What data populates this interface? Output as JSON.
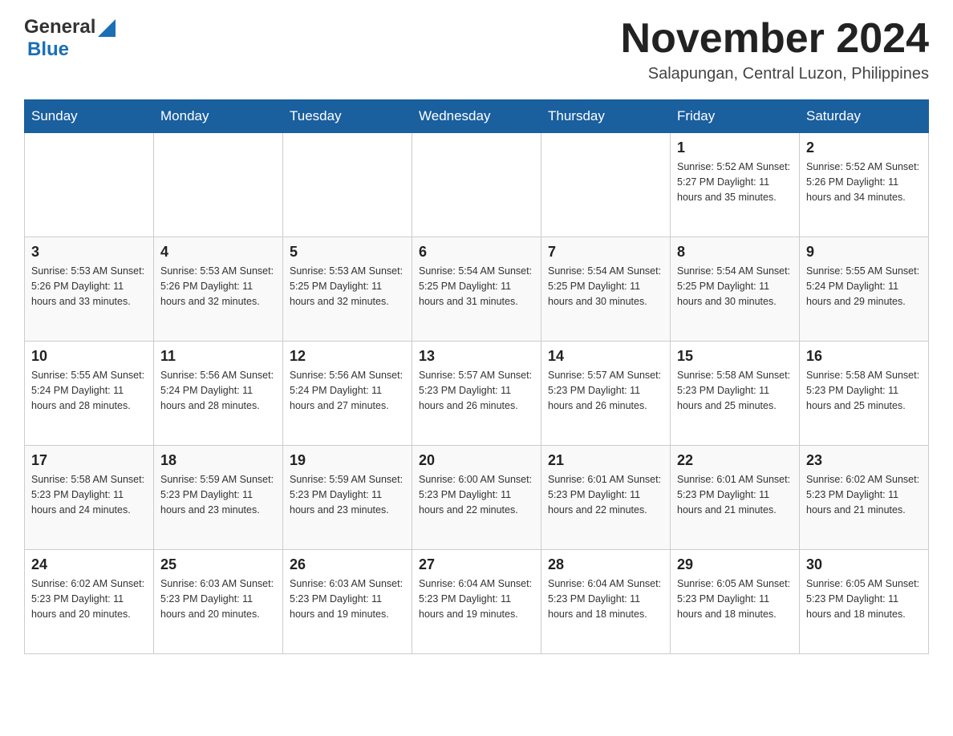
{
  "header": {
    "logo": {
      "text_general": "General",
      "text_blue": "Blue"
    },
    "title": "November 2024",
    "location": "Salapungan, Central Luzon, Philippines"
  },
  "calendar": {
    "days_of_week": [
      "Sunday",
      "Monday",
      "Tuesday",
      "Wednesday",
      "Thursday",
      "Friday",
      "Saturday"
    ],
    "weeks": [
      [
        {
          "day": "",
          "info": ""
        },
        {
          "day": "",
          "info": ""
        },
        {
          "day": "",
          "info": ""
        },
        {
          "day": "",
          "info": ""
        },
        {
          "day": "",
          "info": ""
        },
        {
          "day": "1",
          "info": "Sunrise: 5:52 AM\nSunset: 5:27 PM\nDaylight: 11 hours\nand 35 minutes."
        },
        {
          "day": "2",
          "info": "Sunrise: 5:52 AM\nSunset: 5:26 PM\nDaylight: 11 hours\nand 34 minutes."
        }
      ],
      [
        {
          "day": "3",
          "info": "Sunrise: 5:53 AM\nSunset: 5:26 PM\nDaylight: 11 hours\nand 33 minutes."
        },
        {
          "day": "4",
          "info": "Sunrise: 5:53 AM\nSunset: 5:26 PM\nDaylight: 11 hours\nand 32 minutes."
        },
        {
          "day": "5",
          "info": "Sunrise: 5:53 AM\nSunset: 5:25 PM\nDaylight: 11 hours\nand 32 minutes."
        },
        {
          "day": "6",
          "info": "Sunrise: 5:54 AM\nSunset: 5:25 PM\nDaylight: 11 hours\nand 31 minutes."
        },
        {
          "day": "7",
          "info": "Sunrise: 5:54 AM\nSunset: 5:25 PM\nDaylight: 11 hours\nand 30 minutes."
        },
        {
          "day": "8",
          "info": "Sunrise: 5:54 AM\nSunset: 5:25 PM\nDaylight: 11 hours\nand 30 minutes."
        },
        {
          "day": "9",
          "info": "Sunrise: 5:55 AM\nSunset: 5:24 PM\nDaylight: 11 hours\nand 29 minutes."
        }
      ],
      [
        {
          "day": "10",
          "info": "Sunrise: 5:55 AM\nSunset: 5:24 PM\nDaylight: 11 hours\nand 28 minutes."
        },
        {
          "day": "11",
          "info": "Sunrise: 5:56 AM\nSunset: 5:24 PM\nDaylight: 11 hours\nand 28 minutes."
        },
        {
          "day": "12",
          "info": "Sunrise: 5:56 AM\nSunset: 5:24 PM\nDaylight: 11 hours\nand 27 minutes."
        },
        {
          "day": "13",
          "info": "Sunrise: 5:57 AM\nSunset: 5:23 PM\nDaylight: 11 hours\nand 26 minutes."
        },
        {
          "day": "14",
          "info": "Sunrise: 5:57 AM\nSunset: 5:23 PM\nDaylight: 11 hours\nand 26 minutes."
        },
        {
          "day": "15",
          "info": "Sunrise: 5:58 AM\nSunset: 5:23 PM\nDaylight: 11 hours\nand 25 minutes."
        },
        {
          "day": "16",
          "info": "Sunrise: 5:58 AM\nSunset: 5:23 PM\nDaylight: 11 hours\nand 25 minutes."
        }
      ],
      [
        {
          "day": "17",
          "info": "Sunrise: 5:58 AM\nSunset: 5:23 PM\nDaylight: 11 hours\nand 24 minutes."
        },
        {
          "day": "18",
          "info": "Sunrise: 5:59 AM\nSunset: 5:23 PM\nDaylight: 11 hours\nand 23 minutes."
        },
        {
          "day": "19",
          "info": "Sunrise: 5:59 AM\nSunset: 5:23 PM\nDaylight: 11 hours\nand 23 minutes."
        },
        {
          "day": "20",
          "info": "Sunrise: 6:00 AM\nSunset: 5:23 PM\nDaylight: 11 hours\nand 22 minutes."
        },
        {
          "day": "21",
          "info": "Sunrise: 6:01 AM\nSunset: 5:23 PM\nDaylight: 11 hours\nand 22 minutes."
        },
        {
          "day": "22",
          "info": "Sunrise: 6:01 AM\nSunset: 5:23 PM\nDaylight: 11 hours\nand 21 minutes."
        },
        {
          "day": "23",
          "info": "Sunrise: 6:02 AM\nSunset: 5:23 PM\nDaylight: 11 hours\nand 21 minutes."
        }
      ],
      [
        {
          "day": "24",
          "info": "Sunrise: 6:02 AM\nSunset: 5:23 PM\nDaylight: 11 hours\nand 20 minutes."
        },
        {
          "day": "25",
          "info": "Sunrise: 6:03 AM\nSunset: 5:23 PM\nDaylight: 11 hours\nand 20 minutes."
        },
        {
          "day": "26",
          "info": "Sunrise: 6:03 AM\nSunset: 5:23 PM\nDaylight: 11 hours\nand 19 minutes."
        },
        {
          "day": "27",
          "info": "Sunrise: 6:04 AM\nSunset: 5:23 PM\nDaylight: 11 hours\nand 19 minutes."
        },
        {
          "day": "28",
          "info": "Sunrise: 6:04 AM\nSunset: 5:23 PM\nDaylight: 11 hours\nand 18 minutes."
        },
        {
          "day": "29",
          "info": "Sunrise: 6:05 AM\nSunset: 5:23 PM\nDaylight: 11 hours\nand 18 minutes."
        },
        {
          "day": "30",
          "info": "Sunrise: 6:05 AM\nSunset: 5:23 PM\nDaylight: 11 hours\nand 18 minutes."
        }
      ]
    ]
  }
}
